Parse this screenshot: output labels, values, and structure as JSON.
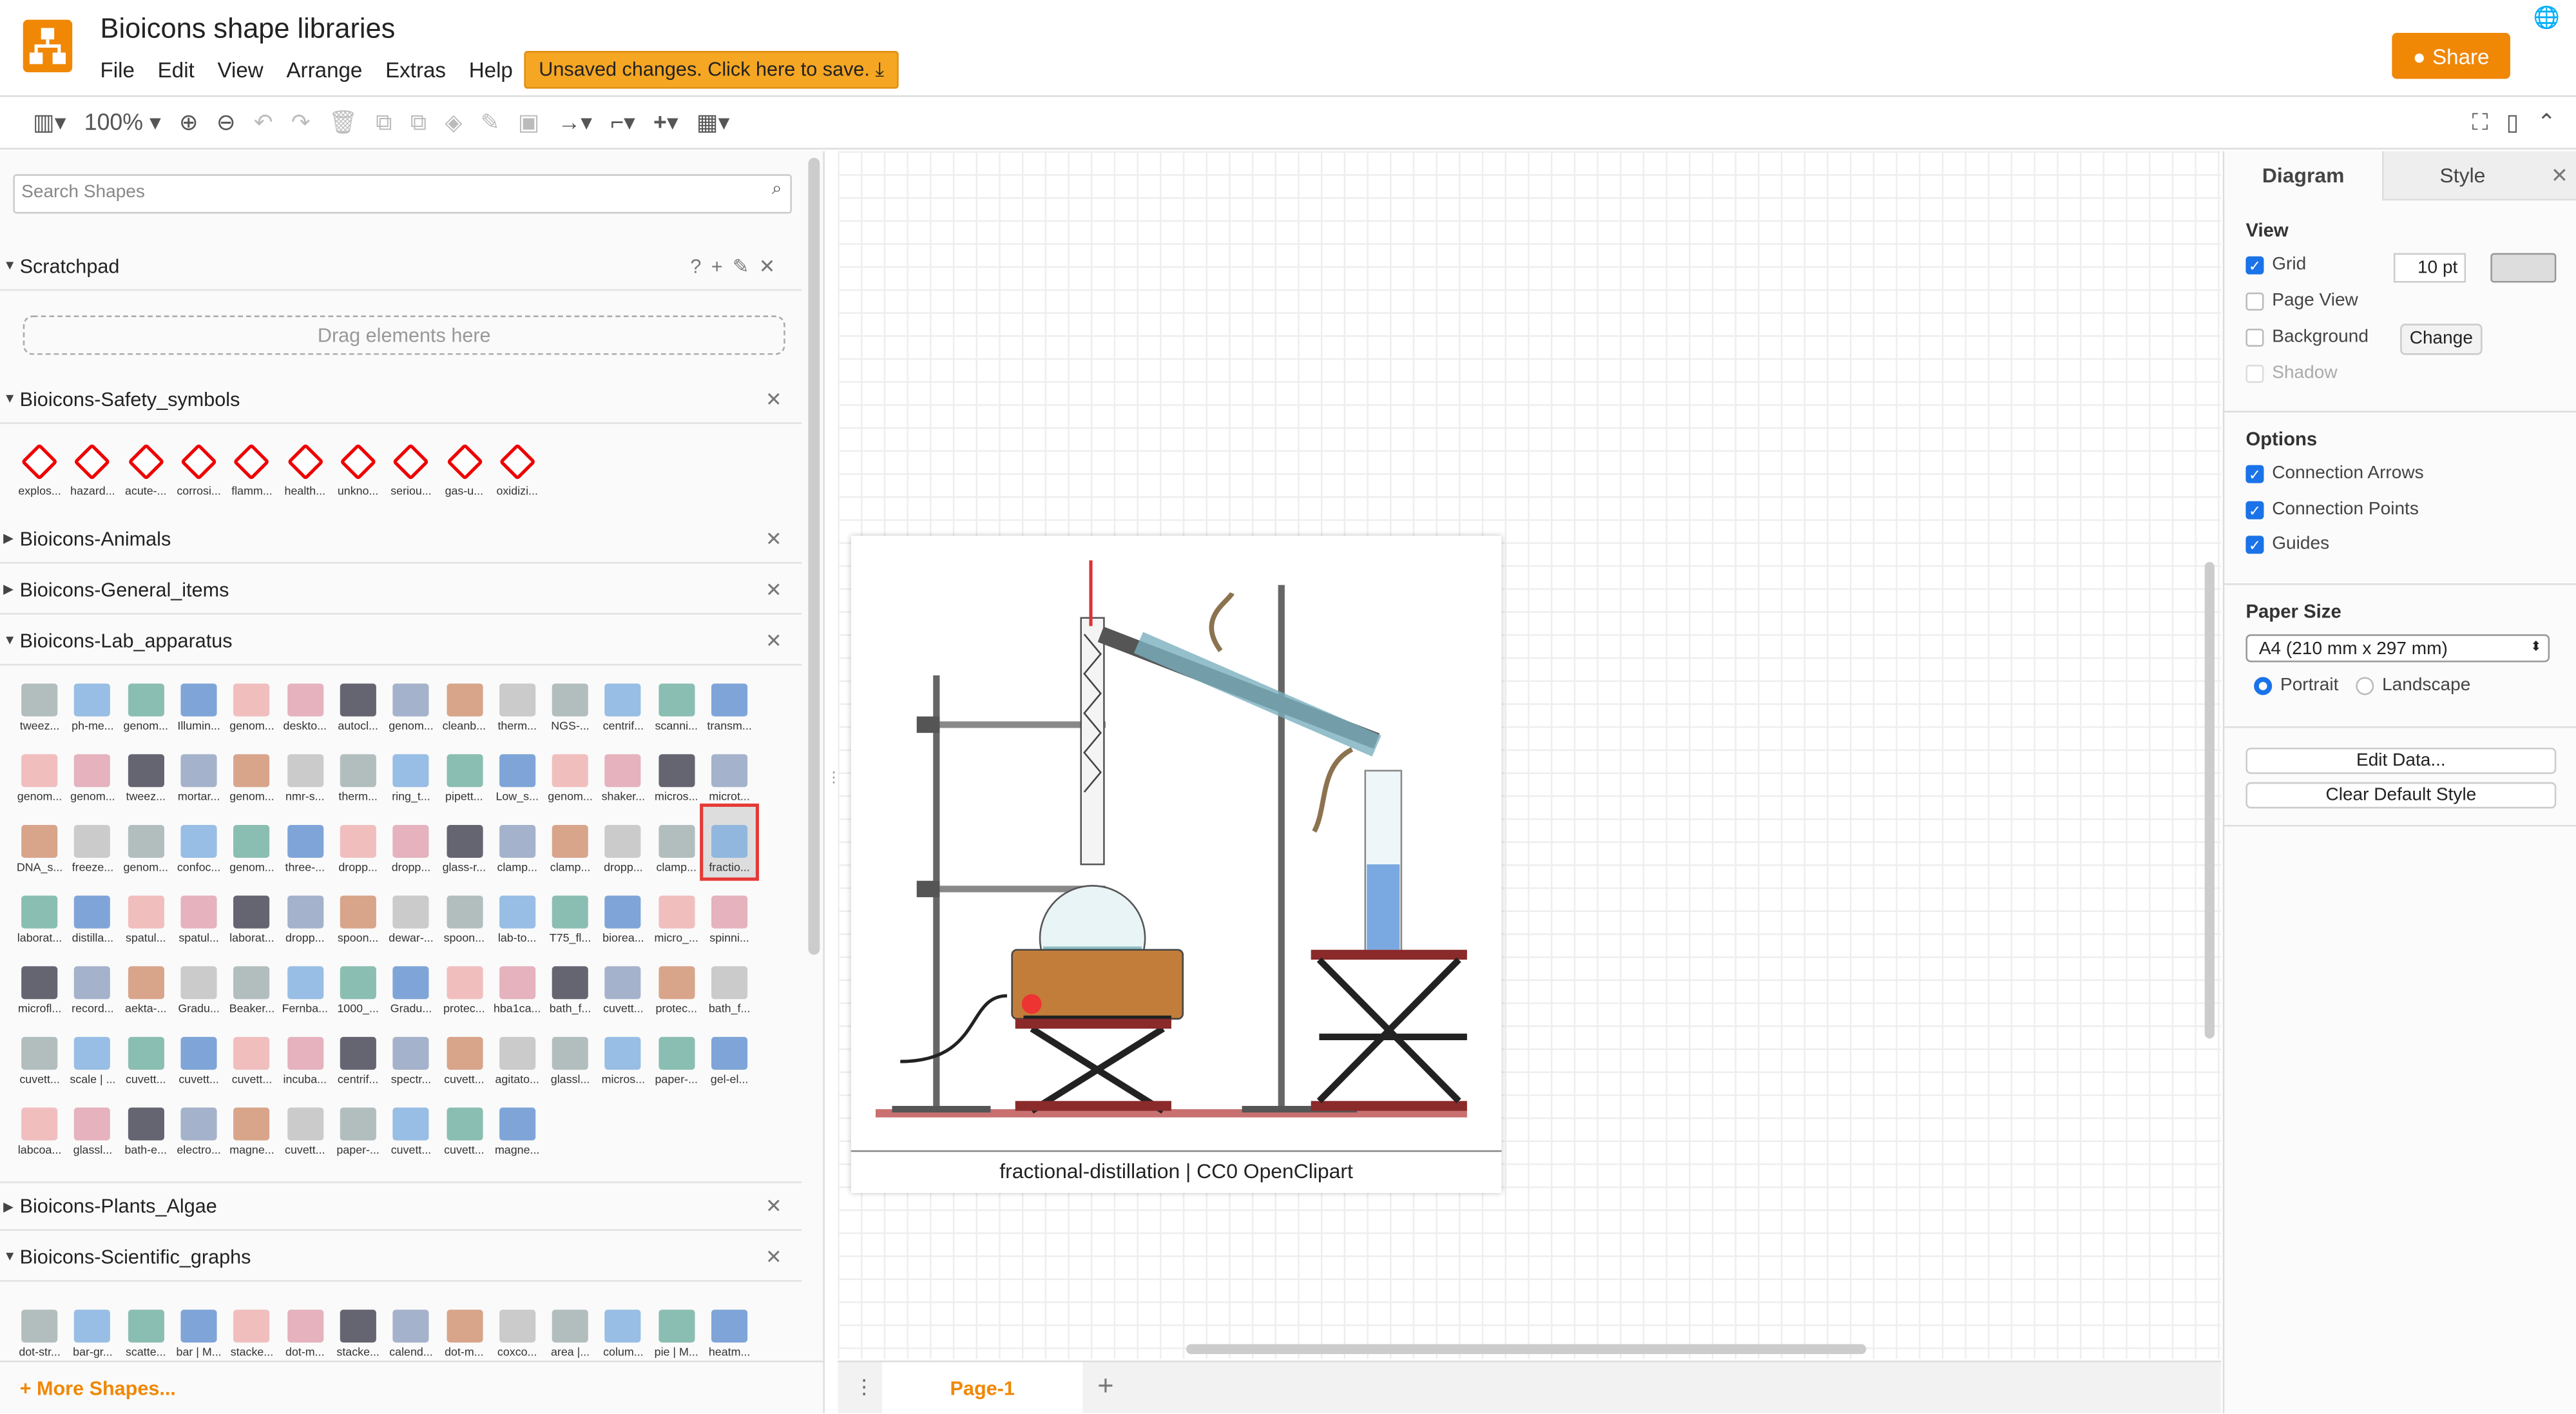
{
  "app": {
    "title": "Bioicons shape libraries",
    "unsaved": "Unsaved changes. Click here to save.",
    "share": "Share",
    "menu": [
      "File",
      "Edit",
      "View",
      "Arrange",
      "Extras",
      "Help"
    ]
  },
  "toolbar": {
    "zoom": "100%"
  },
  "sidebar": {
    "search_placeholder": "Search Shapes",
    "scratchpad": "Scratchpad",
    "drag_hint": "Drag elements here",
    "libraries": {
      "safety": {
        "title": "Bioicons-Safety_symbols",
        "items": [
          "explos...",
          "hazard...",
          "acute-...",
          "corrosi...",
          "flamm...",
          "health...",
          "unkno...",
          "seriou...",
          "gas-u...",
          "oxidizi..."
        ]
      },
      "animals": "Bioicons-Animals",
      "general": "Bioicons-General_items",
      "lab": {
        "title": "Bioicons-Lab_apparatus",
        "items": [
          "tweez...",
          "ph-me...",
          "genom...",
          "Illumin...",
          "genom...",
          "deskto...",
          "autocl...",
          "genom...",
          "cleanb...",
          "therm...",
          "NGS-...",
          "centrif...",
          "scanni...",
          "transm...",
          "genom...",
          "genom...",
          "tweez...",
          "mortar...",
          "genom...",
          "nmr-s...",
          "therm...",
          "ring_t...",
          "pipett...",
          "Low_s...",
          "genom...",
          "shaker...",
          "micros...",
          "microt...",
          "DNA_s...",
          "freeze...",
          "genom...",
          "confoc...",
          "genom...",
          "three-...",
          "dropp...",
          "dropp...",
          "glass-r...",
          "clamp...",
          "clamp...",
          "dropp...",
          "clamp...",
          "fractio...",
          "laborat...",
          "distilla...",
          "spatul...",
          "spatul...",
          "laborat...",
          "dropp...",
          "spoon...",
          "dewar-...",
          "spoon...",
          "lab-to...",
          "T75_fl...",
          "biorea...",
          "micro_...",
          "spinni...",
          "microfl...",
          "record...",
          "aekta-...",
          "Gradu...",
          "Beaker...",
          "Fernba...",
          "1000_...",
          "Gradu...",
          "protec...",
          "hba1ca...",
          "bath_f...",
          "cuvett...",
          "protec...",
          "bath_f...",
          "cuvett...",
          "scale | ...",
          "cuvett...",
          "cuvett...",
          "cuvett...",
          "incuba...",
          "centrif...",
          "spectr...",
          "cuvett...",
          "agitato...",
          "glassl...",
          "micros...",
          "paper-...",
          "gel-el...",
          "labcoa...",
          "glassl...",
          "bath-e...",
          "electro...",
          "magne...",
          "cuvett...",
          "paper-...",
          "cuvett...",
          "cuvett...",
          "magne..."
        ]
      },
      "plants": "Bioicons-Plants_Algae",
      "graphs": {
        "title": "Bioicons-Scientific_graphs",
        "items": [
          "dot-str...",
          "bar-gr...",
          "scatte...",
          "bar | M...",
          "stacke...",
          "dot-m...",
          "stacke...",
          "calend...",
          "dot-m...",
          "coxco...",
          "area |...",
          "colum...",
          "pie | M...",
          "heatm..."
        ]
      }
    },
    "more_shapes": "More Shapes..."
  },
  "canvas": {
    "caption": "fractional-distillation | CC0 OpenClipart",
    "page_tab": "Page-1"
  },
  "format_panel": {
    "tabs": [
      "Diagram",
      "Style"
    ],
    "view": "View",
    "grid": "Grid",
    "grid_size": "10 pt",
    "page_view": "Page View",
    "background": "Background",
    "change": "Change",
    "shadow": "Shadow",
    "options": "Options",
    "connection_arrows": "Connection Arrows",
    "connection_points": "Connection Points",
    "guides": "Guides",
    "paper_size": "Paper Size",
    "paper_value": "A4 (210 mm x 297 mm)",
    "portrait": "Portrait",
    "landscape": "Landscape",
    "edit_data": "Edit Data...",
    "clear_style": "Clear Default Style",
    "checked": {
      "grid": true,
      "page_view": false,
      "background": false,
      "shadow": false,
      "connection_arrows": true,
      "connection_points": true,
      "guides": true
    }
  },
  "colors": {
    "accent": "#f08705",
    "selection": "#e53935",
    "checkbox": "#1a73e8"
  }
}
